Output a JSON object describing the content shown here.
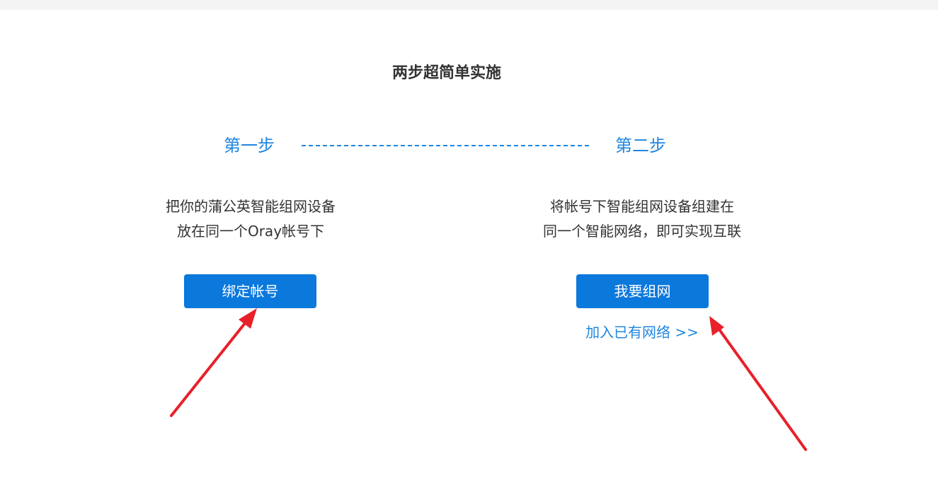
{
  "heading": "两步超简单实施",
  "steps": [
    {
      "label": "第一步",
      "desc_line1": "把你的蒲公英智能组网设备",
      "desc_line2": "放在同一个Oray帐号下",
      "button_label": "绑定帐号"
    },
    {
      "label": "第二步",
      "desc_line1": "将帐号下智能组网设备组建在",
      "desc_line2": "同一个智能网络，即可实现互联",
      "button_label": "我要组网",
      "link_label": "加入已有网络 >>"
    }
  ],
  "colors": {
    "accent": "#1f86e0",
    "button": "#0b78dc",
    "arrow": "#e8202a",
    "text": "#333333"
  }
}
